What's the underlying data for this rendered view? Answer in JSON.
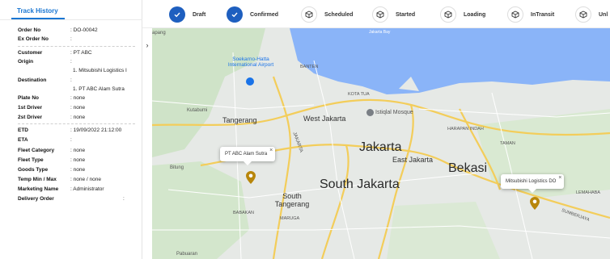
{
  "panel": {
    "title": "Track History",
    "rows": [
      {
        "label": "Order No",
        "value": ": DO-00042"
      },
      {
        "label": "Ex Order No",
        "value": ":"
      },
      {
        "label": "Customer",
        "value": ": PT ABC"
      },
      {
        "label": "Origin",
        "value": ":"
      },
      {
        "label": "",
        "value": "1. Mitsubishi Logistics I"
      },
      {
        "label": "Destination",
        "value": ":"
      },
      {
        "label": "",
        "value": "1. PT ABC Alam Sutra"
      },
      {
        "label": "Plate No",
        "value": ": none"
      },
      {
        "label": "1st Driver",
        "value": ": none"
      },
      {
        "label": "2st Driver",
        "value": ": none"
      },
      {
        "label": "ETD",
        "value": ": 19/09/2022 21:12:00"
      },
      {
        "label": "ETA",
        "value": ":"
      },
      {
        "label": "Fleet Category",
        "value": ": none"
      },
      {
        "label": "Fleet Type",
        "value": ": none"
      },
      {
        "label": "Goods Type",
        "value": ": none"
      },
      {
        "label": "Temp Min / Max",
        "value": ": none / none"
      },
      {
        "label": "Marketing Name",
        "value": ": Administrator"
      },
      {
        "label": "Delivery Order",
        "value": ":"
      }
    ]
  },
  "steps": [
    {
      "label": "Draft",
      "state": "done",
      "icon": "check-icon"
    },
    {
      "label": "Confirmed",
      "state": "done",
      "icon": "check-icon"
    },
    {
      "label": "Scheduled",
      "state": "pending",
      "icon": "box-icon"
    },
    {
      "label": "Started",
      "state": "pending",
      "icon": "box-icon"
    },
    {
      "label": "Loading",
      "state": "pending",
      "icon": "box-icon"
    },
    {
      "label": "InTransit",
      "state": "pending",
      "icon": "box-icon"
    },
    {
      "label": "Unl",
      "state": "pending",
      "icon": "box-icon"
    }
  ],
  "map": {
    "places": {
      "jakarta": "Jakarta",
      "south_jakarta": "South Jakarta",
      "bekasi": "Bekasi",
      "west_jakarta": "West Jakarta",
      "east_jakarta": "East Jakarta",
      "tangerang": "Tangerang",
      "south_tangerang": "South Tangerang",
      "kutabumi": "Kutabumi",
      "bitung": "Bitung",
      "airport": "Soekarno-Hatta International Airport",
      "mosque": "Istiqlal Mosque",
      "jakarta_bay": "Jakarta Bay",
      "pipang": "apang",
      "banten": "BANTEN",
      "jakarta_vert": "JAKARTA",
      "kota_tua": "KOTA TUA",
      "harapan_indah": "HARAPAN INDAH",
      "taman": "TAMAN",
      "babakan": "BABAKAN",
      "maruga": "MARUGA",
      "lemahabang": "LEMAHABA",
      "sumber_jaya": "SUMBERJAYA",
      "pabuaran": "Pabuaran"
    },
    "markers": [
      {
        "name": "PT ABC Alam Sutra"
      },
      {
        "name": "Mitsubishi Logistics DO"
      }
    ]
  },
  "colors": {
    "accent": "#1976d2",
    "step_done": "#1e5fbf",
    "marker": "#b8860b"
  }
}
